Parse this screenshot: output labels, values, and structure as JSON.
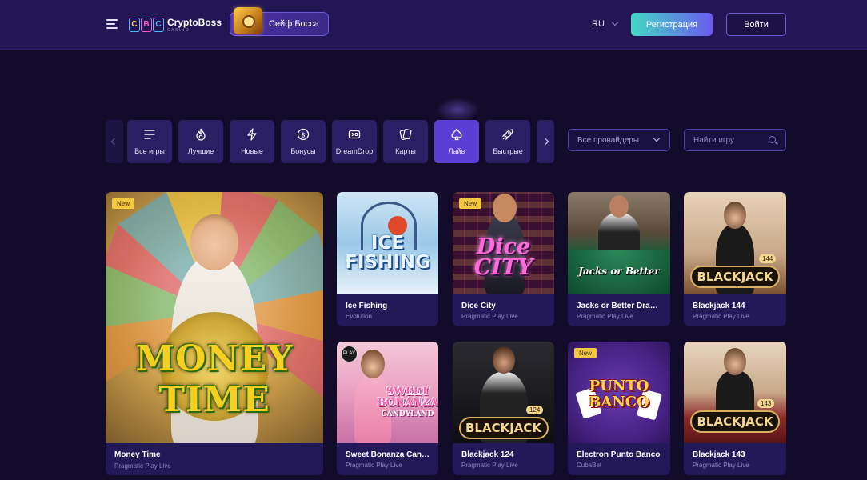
{
  "header": {
    "logo_letters": [
      "C",
      "B",
      "C"
    ],
    "logo_name": "CryptoBoss",
    "logo_sub": "CASINO",
    "safe_label": "Сейф Босса",
    "language": "RU",
    "register_label": "Регистрация",
    "login_label": "Войти"
  },
  "categories": [
    {
      "label": "Все игры",
      "icon": "list-icon"
    },
    {
      "label": "Лучшие",
      "icon": "flame-icon"
    },
    {
      "label": "Новые",
      "icon": "lightning-icon"
    },
    {
      "label": "Бонусы",
      "icon": "dollar-coin-icon"
    },
    {
      "label": "DreamDrop",
      "icon": "dreamdrop-icon"
    },
    {
      "label": "Карты",
      "icon": "cards-icon"
    },
    {
      "label": "Лайв",
      "icon": "spade-icon",
      "active": true
    },
    {
      "label": "Быстрые",
      "icon": "rocket-icon"
    }
  ],
  "filters": {
    "provider_value": "Все провайдеры",
    "search_placeholder": "Найти игру"
  },
  "games": [
    {
      "title": "Money Time",
      "provider": "Pragmatic Play Live",
      "badge": "New",
      "art": "MONEY TIME"
    },
    {
      "title": "Ice Fishing",
      "provider": "Evolution",
      "art": "ICE FISHING"
    },
    {
      "title": "Dice City",
      "provider": "Pragmatic Play Live",
      "badge": "New",
      "art": "Dice CITY"
    },
    {
      "title": "Jacks or Better Draw Poker",
      "provider": "Pragmatic Play Live",
      "art": "Jacks or Better"
    },
    {
      "title": "Blackjack 144",
      "provider": "Pragmatic Play Live",
      "art": "BLACKJACK",
      "table_number": "144"
    },
    {
      "title": "Sweet Bonanza CandyLand",
      "provider": "Pragmatic Play Live",
      "badge_play": "PLAY",
      "art": "SWEET BONANZA",
      "art_sub": "CANDYLAND"
    },
    {
      "title": "Blackjack 124",
      "provider": "Pragmatic Play Live",
      "art": "BLACKJACK",
      "table_number": "124"
    },
    {
      "title": "Electron Punto Banco",
      "provider": "CubaBet",
      "badge": "New",
      "art": "PUNTO BANCO"
    },
    {
      "title": "Blackjack 143",
      "provider": "Pragmatic Play Live",
      "art": "BLACKJACK",
      "table_number": "143"
    }
  ],
  "colors": {
    "background": "#120b2a",
    "header": "#231654",
    "accent": "#5b3fd4",
    "card": "#231858",
    "badge": "#f5c842"
  }
}
